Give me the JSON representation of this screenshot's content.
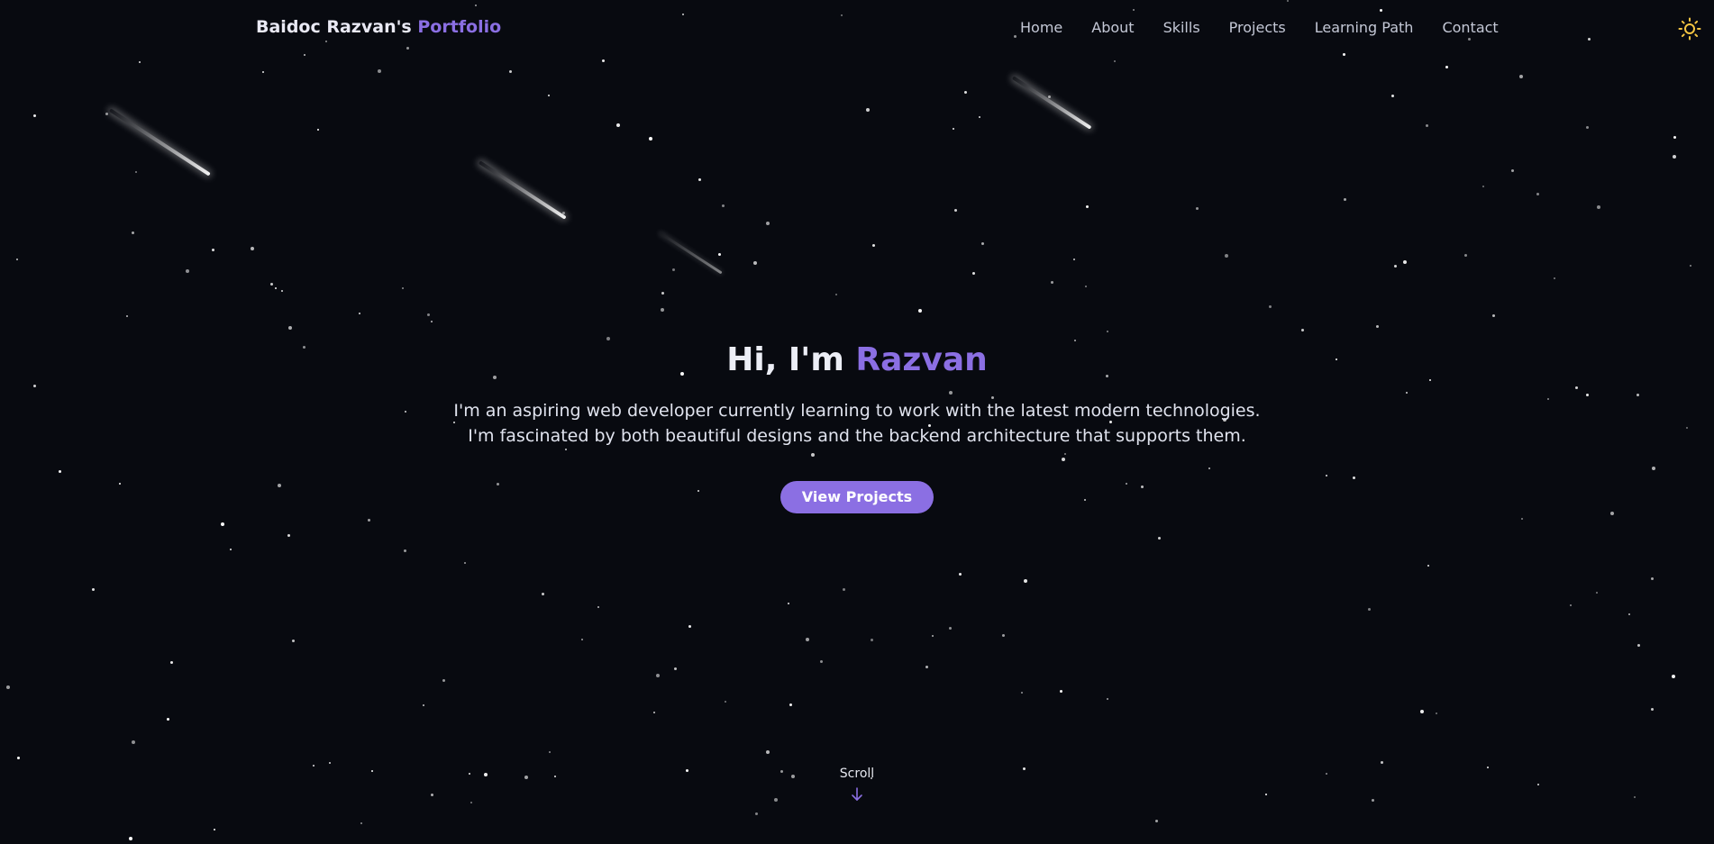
{
  "navbar": {
    "brand_prefix": "Baidoc Razvan's",
    "brand_accent": "Portfolio",
    "links": [
      "Home",
      "About",
      "Skills",
      "Projects",
      "Learning Path",
      "Contact"
    ],
    "theme_icon": "sun-icon"
  },
  "hero": {
    "greeting": "Hi, I'm",
    "name": "Razvan",
    "desc_line1": "I'm an aspiring web developer currently learning to work with the latest modern technologies.",
    "desc_line2": "I'm fascinated by both beautiful designs and the backend architecture that supports them.",
    "cta_label": "View Projects"
  },
  "scroll": {
    "label": "Scroll",
    "icon": "arrow-down-icon"
  },
  "theme": {
    "background": "#080a10",
    "accent": "#8b6fe3",
    "text": "#e6e8f0",
    "sun": "#f5c542"
  }
}
